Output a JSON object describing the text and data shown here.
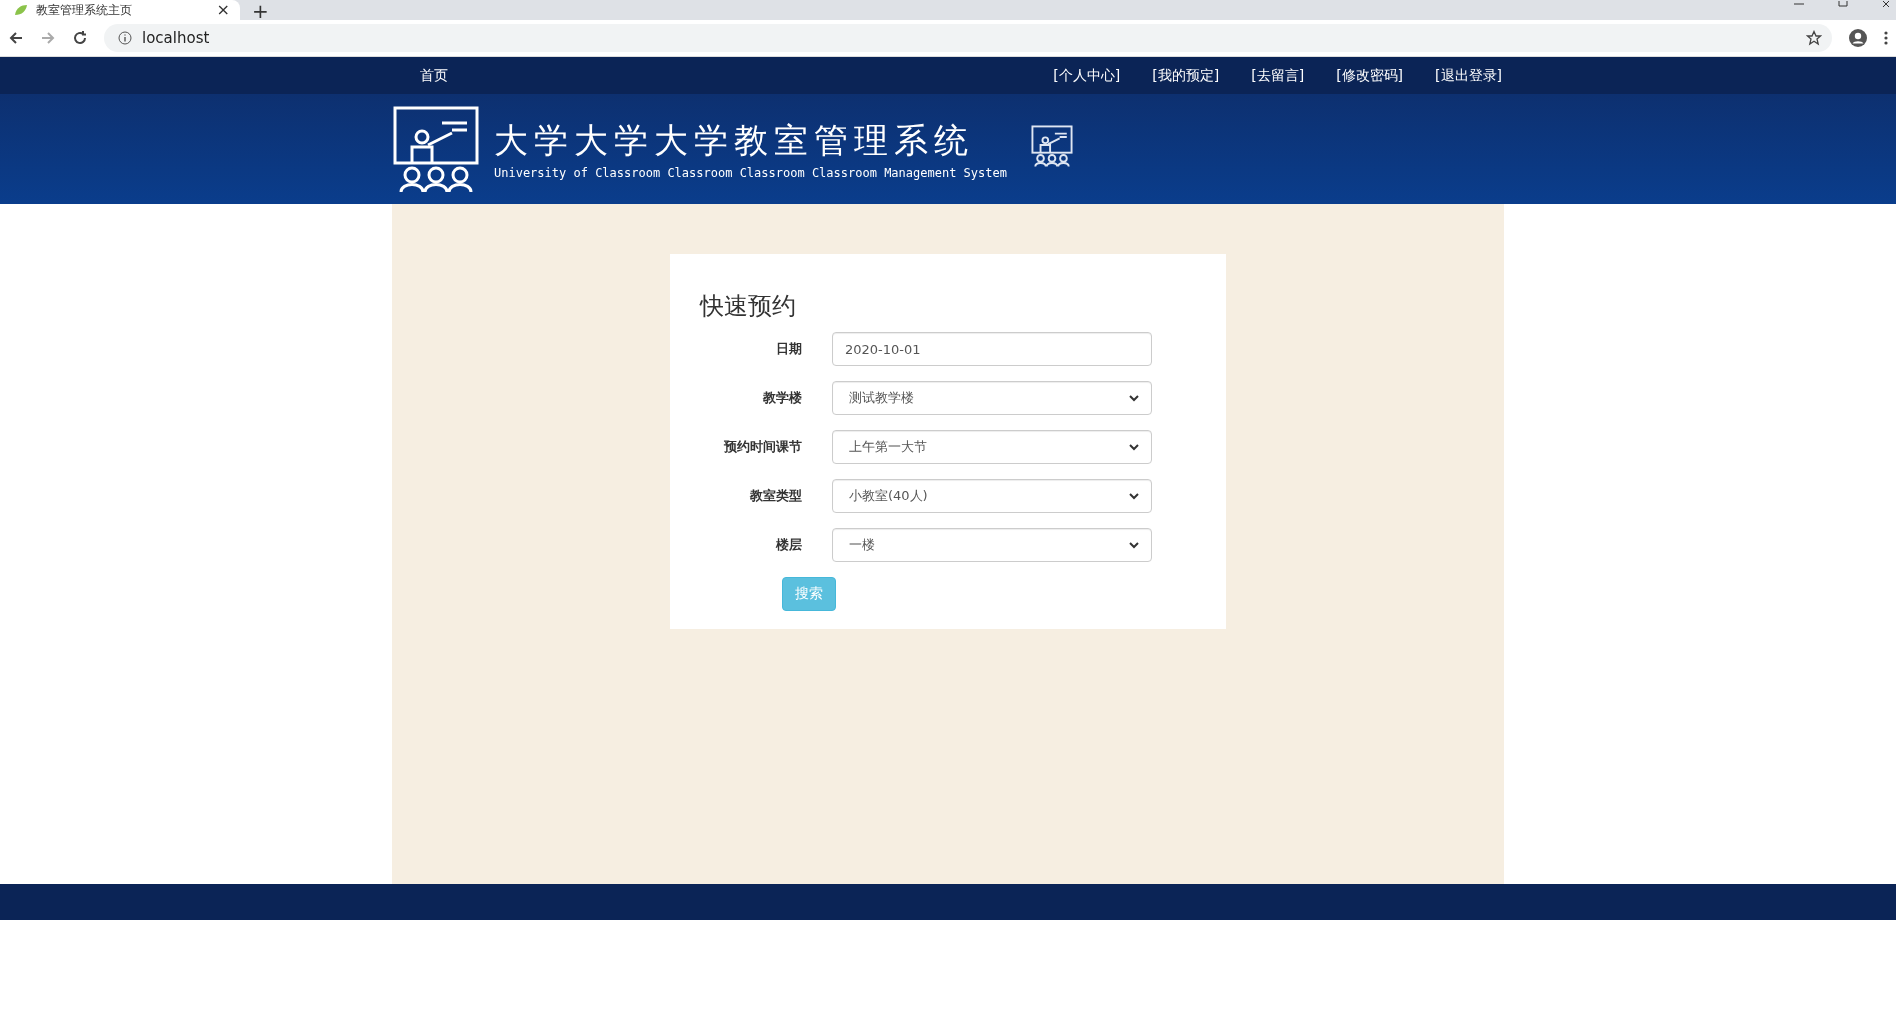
{
  "browser": {
    "tab_title": "教室管理系统主页",
    "tab_close": "×",
    "new_tab": "+",
    "address": "localhost"
  },
  "nav": {
    "home": "首页",
    "links": [
      "[个人中心]",
      "[我的预定]",
      "[去留言]",
      "[修改密码]",
      "[退出登录]"
    ]
  },
  "header": {
    "title": "大学大学大学教室管理系统",
    "subtitle": "University of Classroom Classroom Classroom Classroom Management System"
  },
  "form": {
    "title": "快速预约",
    "fields": [
      {
        "kind": "input",
        "label": "日期",
        "value": "2020-10-01"
      },
      {
        "kind": "select",
        "label": "教学楼",
        "value": "测试教学楼"
      },
      {
        "kind": "select",
        "label": "预约时间课节",
        "value": "上午第一大节"
      },
      {
        "kind": "select",
        "label": "教室类型",
        "value": "小教室(40人)"
      },
      {
        "kind": "select",
        "label": "楼层",
        "value": "一楼"
      }
    ],
    "button": "搜索"
  }
}
